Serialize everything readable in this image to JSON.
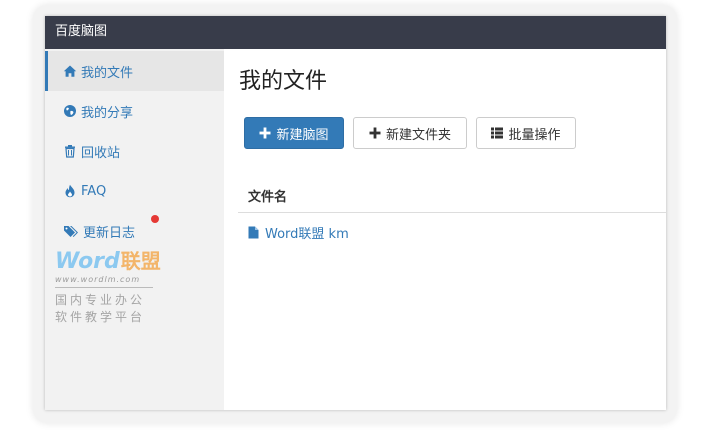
{
  "app": {
    "title": "百度脑图"
  },
  "sidebar": {
    "items": [
      {
        "label": "我的文件",
        "icon": "home-icon",
        "active": true
      },
      {
        "label": "我的分享",
        "icon": "globe-icon",
        "active": false
      },
      {
        "label": "回收站",
        "icon": "trash-icon",
        "active": false
      },
      {
        "label": "FAQ",
        "icon": "fire-icon",
        "active": false
      },
      {
        "label": "更新日志",
        "icon": "tags-icon",
        "active": false,
        "notification_dot": true
      }
    ]
  },
  "watermark": {
    "logo_word": "Word",
    "logo_cn": "联盟",
    "url": "www.wordlm.com",
    "slogan_line1": "国内专业办公",
    "slogan_line2": "软件教学平台"
  },
  "main": {
    "title": "我的文件",
    "toolbar": {
      "new_mindmap_label": "新建脑图",
      "new_folder_label": "新建文件夹",
      "batch_label": "批量操作"
    },
    "table": {
      "column_header": "文件名",
      "files": [
        {
          "name": "Word联盟 km",
          "icon": "file-icon"
        }
      ]
    }
  },
  "colors": {
    "titlebar": "#383c4a",
    "accent": "#337ab7",
    "sidebar_bg": "#f2f2f2",
    "notification": "#e53935"
  }
}
